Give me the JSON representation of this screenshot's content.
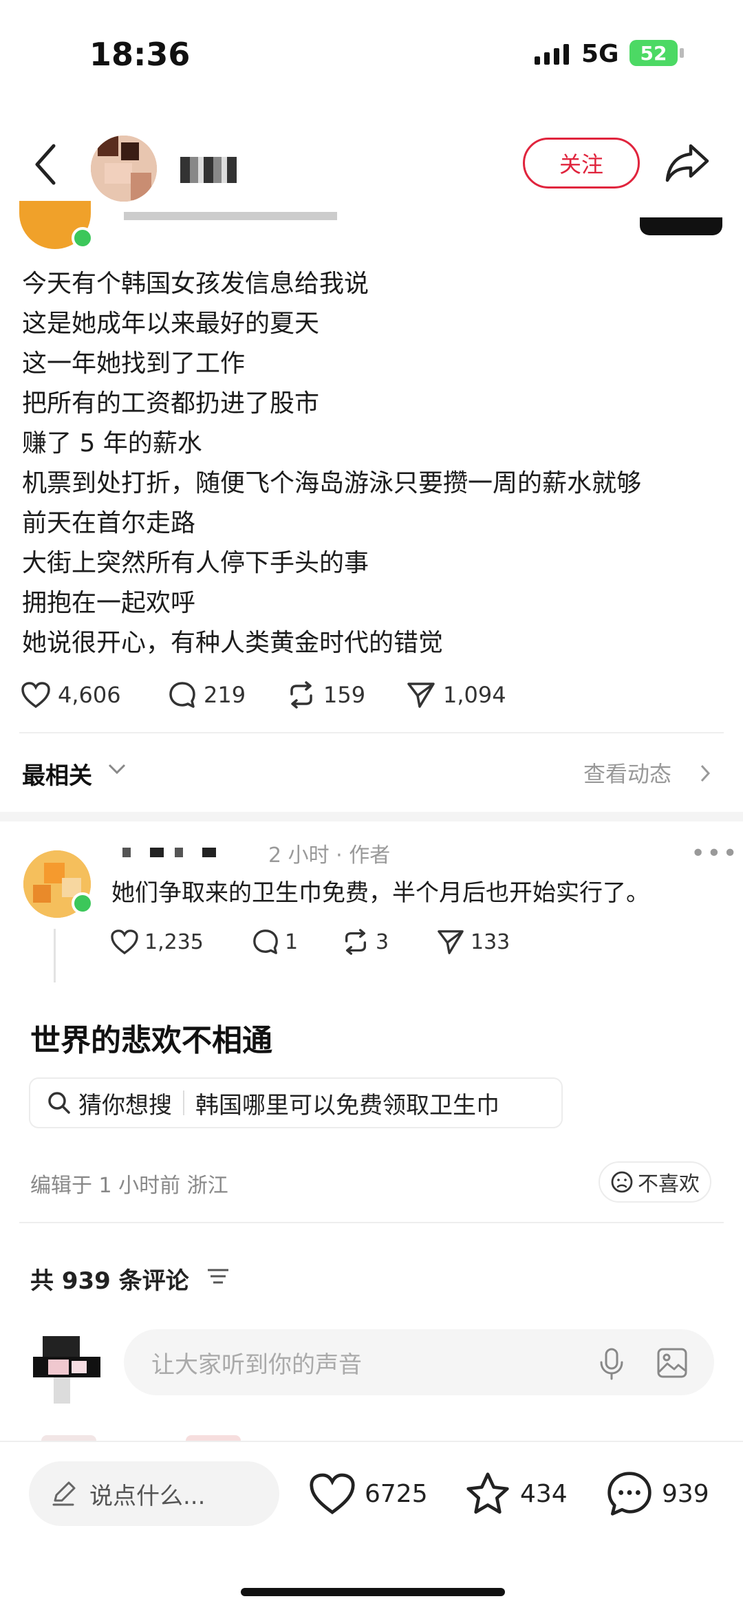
{
  "status_bar": {
    "time": "18:36",
    "network": "5G",
    "battery": "52"
  },
  "header": {
    "follow_label": "关注"
  },
  "post": {
    "lines": [
      "今天有个韩国女孩发信息给我说",
      "这是她成年以来最好的夏天",
      "这一年她找到了工作",
      "把所有的工资都扔进了股市",
      "赚了 5 年的薪水",
      "机票到处打折，随便飞个海岛游泳只要攒一周的薪水就够",
      "前天在首尔走路",
      "大街上突然所有人停下手头的事",
      "拥抱在一起欢呼",
      "她说很开心，有种人类黄金时代的错觉"
    ],
    "stats": {
      "likes": "4,606",
      "comments": "219",
      "reposts": "159",
      "shares": "1,094"
    }
  },
  "sort": {
    "label": "最相关",
    "more_label": "查看动态"
  },
  "comment": {
    "meta": "2 小时 · 作者",
    "text": "她们争取来的卫生巾免费，半个月后也开始实行了。",
    "stats": {
      "likes": "1,235",
      "comments": "1",
      "reposts": "3",
      "shares": "133"
    }
  },
  "topic": {
    "title": "世界的悲欢不相通",
    "search_prefix": "猜你想搜",
    "search_query": "韩国哪里可以免费领取卫生巾",
    "edited": "编辑于 1 小时前 浙江",
    "dislike_label": "不喜欢"
  },
  "comments_section": {
    "count_label": "共 939 条评论",
    "input_placeholder": "让大家听到你的声音"
  },
  "bottom_bar": {
    "say_placeholder": "说点什么...",
    "likes": "6725",
    "favorites": "434",
    "comments": "939"
  },
  "colors": {
    "accent": "#e0243d",
    "online": "#3cc75a"
  }
}
